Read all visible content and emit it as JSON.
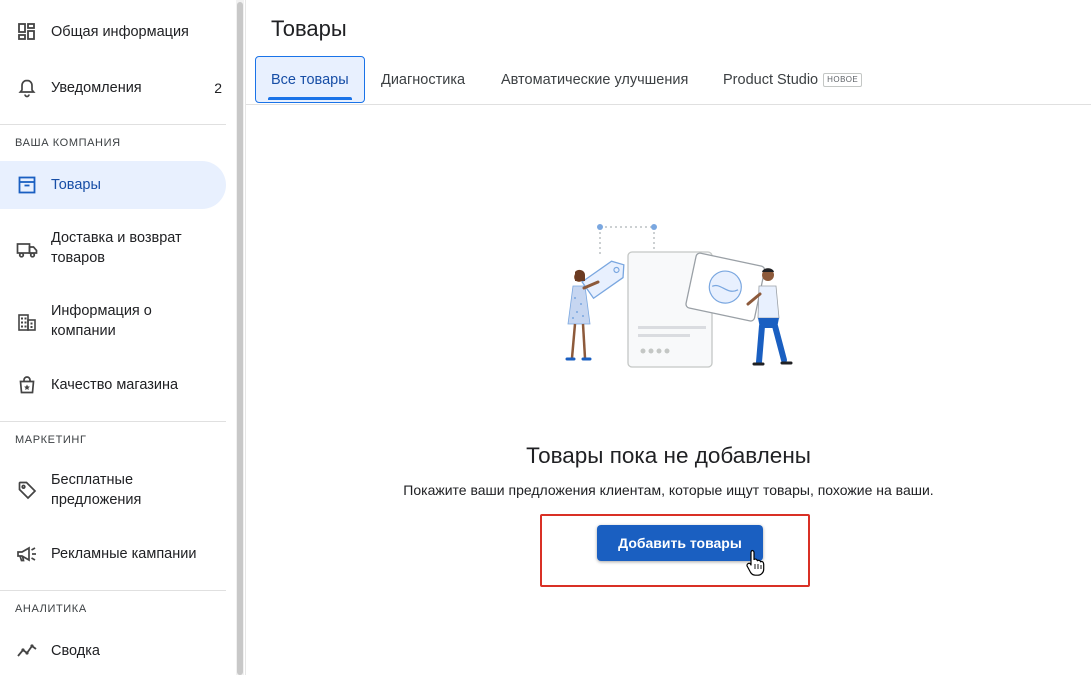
{
  "sidebar": {
    "items": [
      {
        "label": "Общая информация",
        "icon": "dashboard-icon"
      },
      {
        "label": "Уведомления",
        "icon": "bell-icon",
        "badge": "2"
      }
    ],
    "sections": [
      {
        "title": "ВАША КОМПАНИЯ",
        "items": [
          {
            "label": "Товары",
            "icon": "archive-box-icon",
            "active": true
          },
          {
            "label": "Доставка и возврат товаров",
            "line1": "Доставка и возврат",
            "line2": "товаров",
            "icon": "truck-icon"
          },
          {
            "label": "Информация о компании",
            "line1": "Информация о",
            "line2": "компании",
            "icon": "building-icon"
          },
          {
            "label": "Качество магазина",
            "icon": "shopping-bag-icon"
          }
        ]
      },
      {
        "title": "МАРКЕТИНГ",
        "items": [
          {
            "label": "Бесплатные предложения",
            "line1": "Бесплатные",
            "line2": "предложения",
            "icon": "tag-icon"
          },
          {
            "label": "Рекламные кампании",
            "icon": "megaphone-icon"
          }
        ]
      },
      {
        "title": "АНАЛИТИКА",
        "items": [
          {
            "label": "Сводка",
            "icon": "trend-line-icon"
          }
        ]
      }
    ]
  },
  "header": {
    "title": "Товары"
  },
  "tabs": [
    {
      "label": "Все товары",
      "active": true
    },
    {
      "label": "Диагностика"
    },
    {
      "label": "Автоматические улучшения"
    },
    {
      "label": "Product Studio",
      "badge": "НОВОЕ"
    }
  ],
  "empty_state": {
    "title": "Товары пока не добавлены",
    "subtitle": "Покажите ваши предложения клиентам, которые ищут товары, похожие на ваши.",
    "button_label": "Добавить товары"
  },
  "colors": {
    "accent": "#1a73e8",
    "button": "#1a5fc1",
    "active_bg": "#e8f0fe",
    "highlight": "#d93025"
  }
}
